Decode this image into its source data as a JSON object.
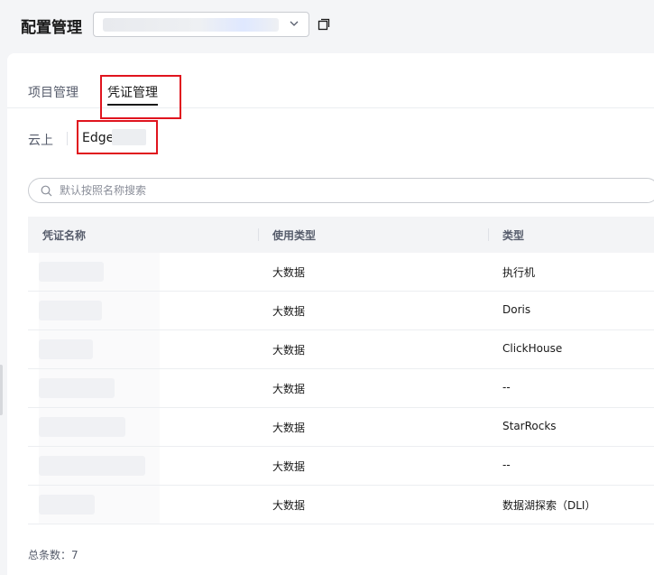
{
  "header": {
    "title": "配置管理",
    "project_select": {
      "value": "",
      "icon": "chevron-down-icon"
    },
    "open_icon": "external-window-icon"
  },
  "tabs": [
    {
      "label": "项目管理",
      "active": false
    },
    {
      "label": "凭证管理",
      "active": true
    }
  ],
  "subtabs": [
    {
      "label": "云上",
      "active": false
    },
    {
      "label": "Edge",
      "active": true
    }
  ],
  "search": {
    "placeholder": "默认按照名称搜索",
    "value": ""
  },
  "table": {
    "columns": [
      "凭证名称",
      "使用类型",
      "类型"
    ],
    "rows": [
      {
        "name": "",
        "usage": "大数据",
        "type": "执行机"
      },
      {
        "name": "",
        "usage": "大数据",
        "type": "Doris"
      },
      {
        "name": "",
        "usage": "大数据",
        "type": "ClickHouse"
      },
      {
        "name": "",
        "usage": "大数据",
        "type": "--"
      },
      {
        "name": "",
        "usage": "大数据",
        "type": "StarRocks"
      },
      {
        "name": "",
        "usage": "大数据",
        "type": "--"
      },
      {
        "name": "",
        "usage": "大数据",
        "type": "数据湖探索（DLI）"
      }
    ]
  },
  "footer": {
    "total": "总条数：7"
  },
  "colors": {
    "highlight_border": "#e0141e",
    "active_tab": "#191919"
  }
}
